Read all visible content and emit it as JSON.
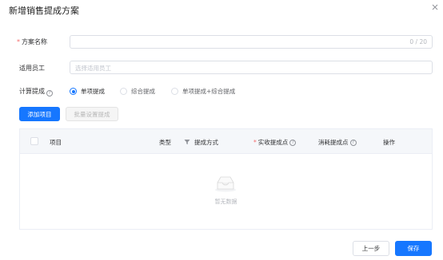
{
  "dialog": {
    "title": "新增销售提成方案"
  },
  "form": {
    "plan_name": {
      "label": "方案名称",
      "required_mark": "*",
      "counter": "0 / 20"
    },
    "employee": {
      "label": "适用员工",
      "placeholder": "选择适用员工"
    },
    "calc": {
      "label": "计算提成",
      "help": "?",
      "options": [
        {
          "label": "单项提成",
          "checked": true
        },
        {
          "label": "综合提成",
          "checked": false
        },
        {
          "label": "单项提成+综合提成",
          "checked": false
        }
      ]
    }
  },
  "actions": {
    "add_item": "添加项目",
    "batch_set": "批量设置提成"
  },
  "table": {
    "columns": {
      "item": "项目",
      "type": "类型",
      "method": "提成方式",
      "actual_point": "实收提成点",
      "consume_point": "消耗提成点",
      "operation": "操作"
    },
    "required_mark": "*",
    "help": "?",
    "empty_text": "暂无数据"
  },
  "footer": {
    "prev": "上一步",
    "save": "保存"
  },
  "colors": {
    "primary": "#1677ff",
    "required": "#f56c6c",
    "border": "#dcdfe6"
  }
}
